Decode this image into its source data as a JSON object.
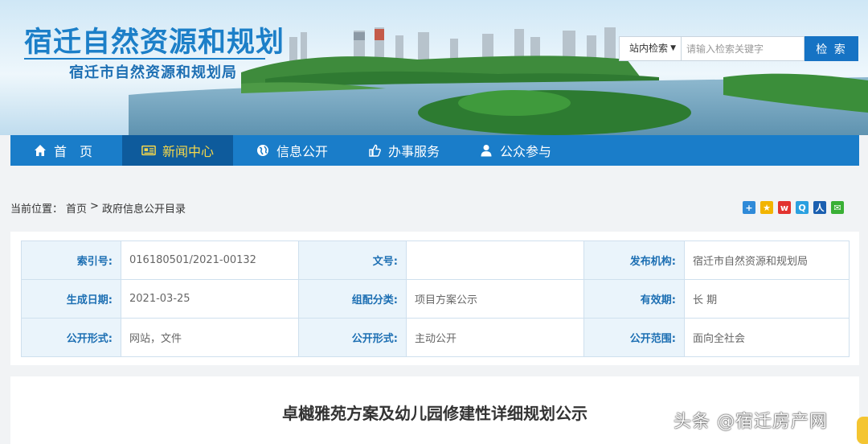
{
  "header": {
    "site_title": "宿迁自然资源和规划",
    "site_subtitle": "宿迁市自然资源和规划局",
    "search": {
      "scope": "站内检索",
      "placeholder": "请输入检索关键字",
      "button": "检 索"
    }
  },
  "nav": {
    "items": [
      {
        "label": "首　页",
        "icon": "home-icon"
      },
      {
        "label": "新闻中心",
        "icon": "newspaper-icon",
        "active": true
      },
      {
        "label": "信息公开",
        "icon": "globe-icon"
      },
      {
        "label": "办事服务",
        "icon": "thumbs-up-icon"
      },
      {
        "label": "公众参与",
        "icon": "user-icon"
      }
    ],
    "colors": {
      "bar": "#1a7dc9",
      "active_bg": "#0e5b9c",
      "active_text": "#f7d84a"
    }
  },
  "breadcrumb": {
    "prefix": "当前位置：",
    "items": [
      "首页",
      ">",
      "政府信息公开目录"
    ]
  },
  "share": [
    "plus-icon",
    "qzone-icon",
    "weibo-icon",
    "tencent-weibo-icon",
    "renren-icon",
    "wechat-icon"
  ],
  "info": {
    "rows": [
      [
        {
          "label": "索引号:",
          "value": "016180501/2021-00132"
        },
        {
          "label": "文号:",
          "value": ""
        },
        {
          "label": "发布机构:",
          "value": "宿迁市自然资源和规划局"
        }
      ],
      [
        {
          "label": "生成日期:",
          "value": "2021-03-25"
        },
        {
          "label": "组配分类:",
          "value": "项目方案公示"
        },
        {
          "label": "有效期:",
          "value": "长 期"
        }
      ],
      [
        {
          "label": "公开形式:",
          "value": "网站，文件"
        },
        {
          "label": "公开形式:",
          "value": "主动公开"
        },
        {
          "label": "公开范围:",
          "value": "面向全社会"
        }
      ]
    ]
  },
  "article": {
    "title": "卓樾雅苑方案及幼儿园修建性详细规划公示"
  },
  "watermark": "头条 @宿迁房产网"
}
